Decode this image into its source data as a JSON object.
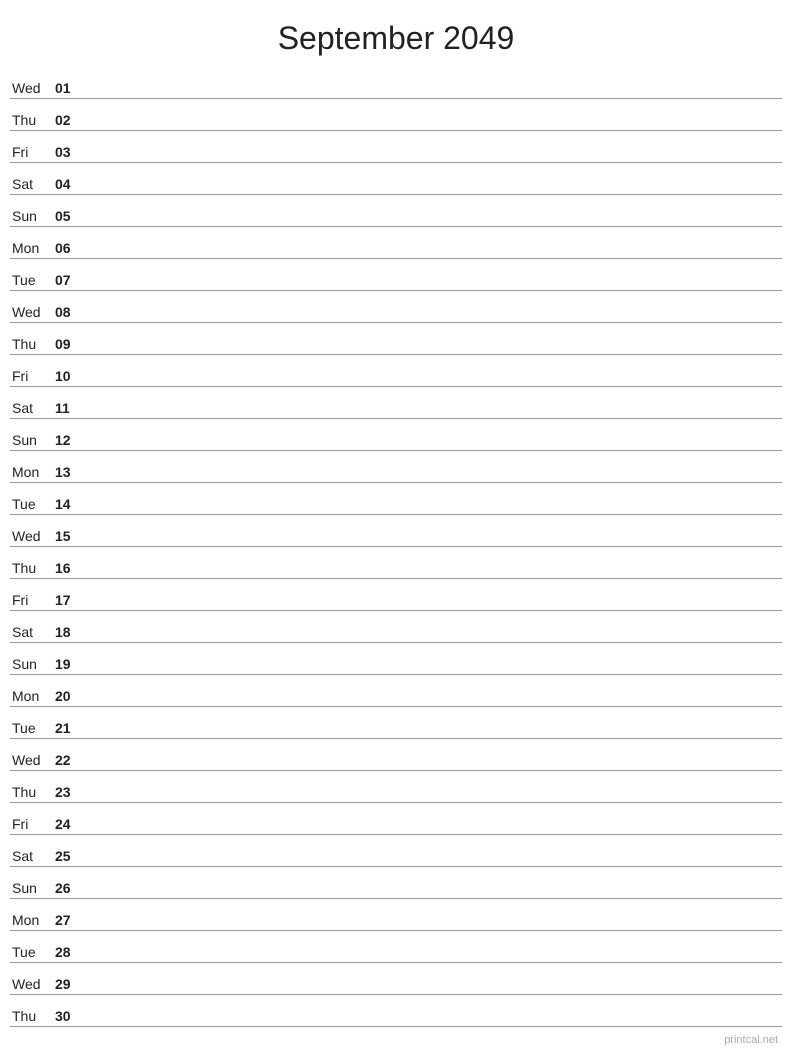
{
  "title": "September 2049",
  "watermark": "printcal.net",
  "days": [
    {
      "name": "Wed",
      "num": "01"
    },
    {
      "name": "Thu",
      "num": "02"
    },
    {
      "name": "Fri",
      "num": "03"
    },
    {
      "name": "Sat",
      "num": "04"
    },
    {
      "name": "Sun",
      "num": "05"
    },
    {
      "name": "Mon",
      "num": "06"
    },
    {
      "name": "Tue",
      "num": "07"
    },
    {
      "name": "Wed",
      "num": "08"
    },
    {
      "name": "Thu",
      "num": "09"
    },
    {
      "name": "Fri",
      "num": "10"
    },
    {
      "name": "Sat",
      "num": "11"
    },
    {
      "name": "Sun",
      "num": "12"
    },
    {
      "name": "Mon",
      "num": "13"
    },
    {
      "name": "Tue",
      "num": "14"
    },
    {
      "name": "Wed",
      "num": "15"
    },
    {
      "name": "Thu",
      "num": "16"
    },
    {
      "name": "Fri",
      "num": "17"
    },
    {
      "name": "Sat",
      "num": "18"
    },
    {
      "name": "Sun",
      "num": "19"
    },
    {
      "name": "Mon",
      "num": "20"
    },
    {
      "name": "Tue",
      "num": "21"
    },
    {
      "name": "Wed",
      "num": "22"
    },
    {
      "name": "Thu",
      "num": "23"
    },
    {
      "name": "Fri",
      "num": "24"
    },
    {
      "name": "Sat",
      "num": "25"
    },
    {
      "name": "Sun",
      "num": "26"
    },
    {
      "name": "Mon",
      "num": "27"
    },
    {
      "name": "Tue",
      "num": "28"
    },
    {
      "name": "Wed",
      "num": "29"
    },
    {
      "name": "Thu",
      "num": "30"
    }
  ]
}
